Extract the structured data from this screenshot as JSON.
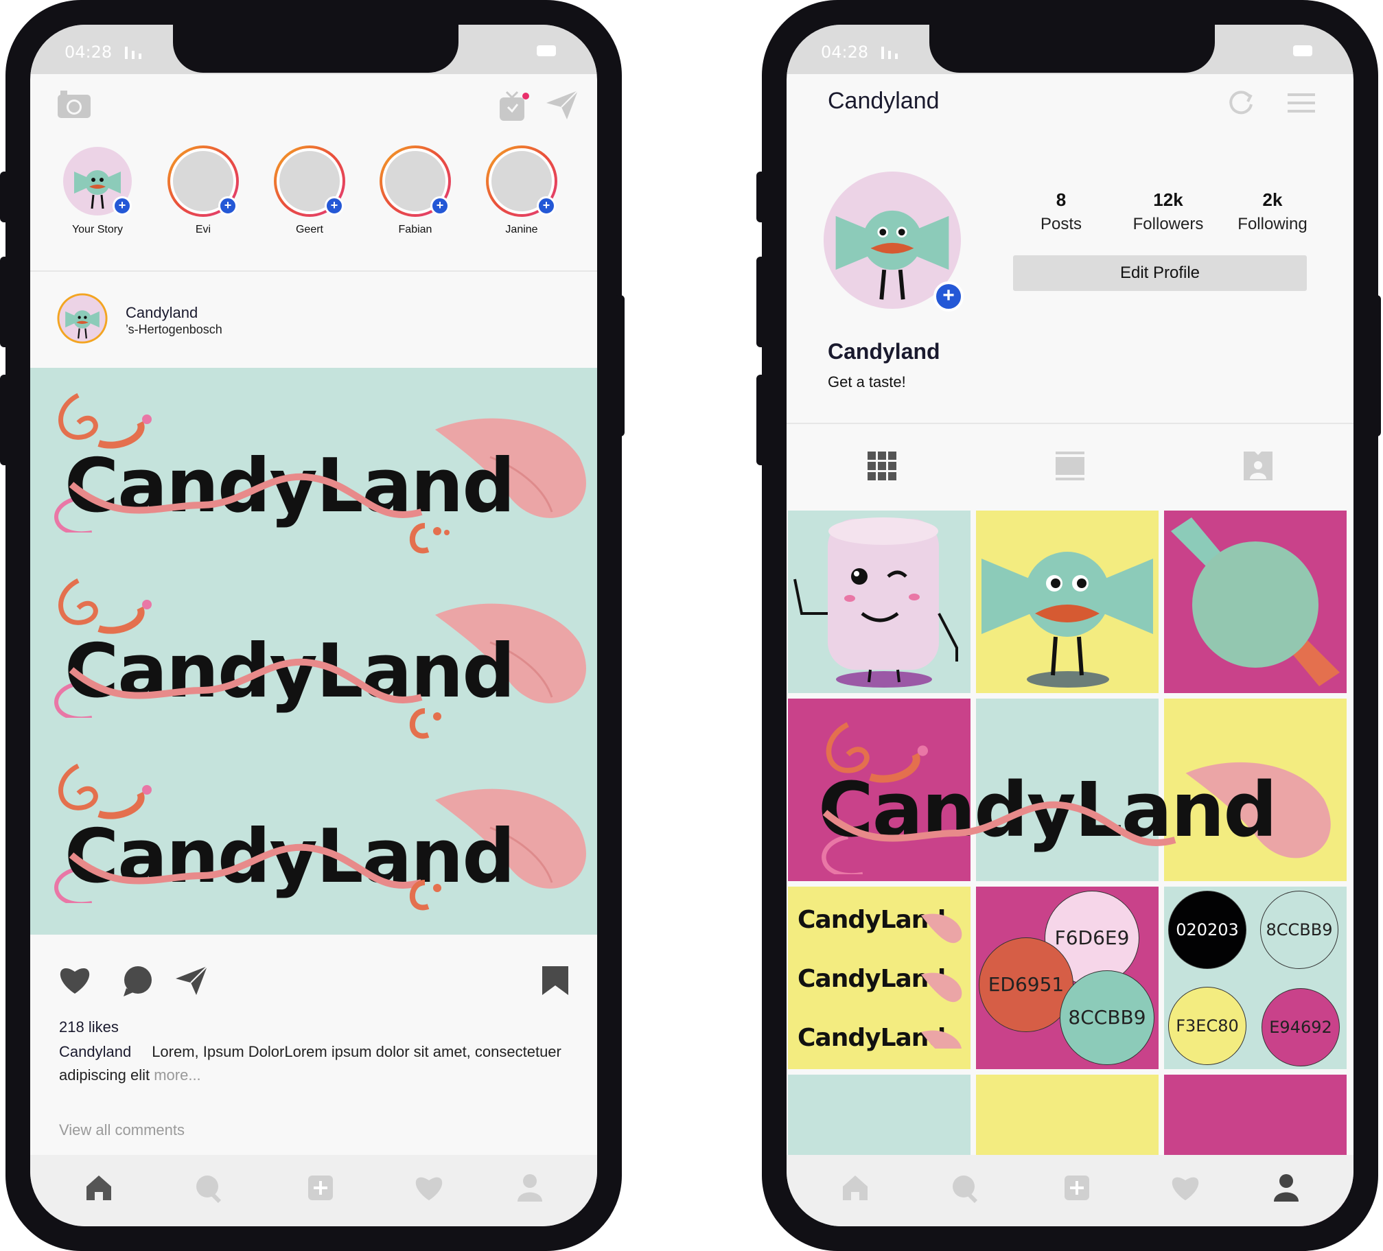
{
  "status_bar": {
    "time": "04:28"
  },
  "feed": {
    "stories": [
      {
        "name": "Your Story"
      },
      {
        "name": "Evi"
      },
      {
        "name": "Geert"
      },
      {
        "name": "Fabian"
      },
      {
        "name": "Janine"
      }
    ],
    "post": {
      "account": "Candyland",
      "location": "’s-Hertogenbosch",
      "image_text": "CandyLand",
      "likes": "218 likes",
      "caption_user": "Candyland",
      "caption_text": "Lorem, Ipsum DolorLorem ipsum dolor sit amet, consectetuer adipiscing elit",
      "more": "more...",
      "view_comments": "View all comments"
    }
  },
  "profile": {
    "header_title": "Candyland",
    "stats": [
      {
        "value": "8",
        "label": "Posts"
      },
      {
        "value": "12k",
        "label": "Followers"
      },
      {
        "value": "2k",
        "label": "Following"
      }
    ],
    "edit_button": "Edit Profile",
    "name": "Candyland",
    "bio": "Get a taste!",
    "grid_logo_text": "CandyLand",
    "swatches_a": [
      "F6D6E9",
      "ED6951",
      "8CCBB9"
    ],
    "swatches_b": [
      "020203",
      "8CCBB9",
      "F3EC80",
      "E94692"
    ]
  },
  "colors": {
    "mint": "#c5e3dc",
    "teal": "#8ccbb9",
    "yellow": "#f3ec80",
    "magenta": "#c9428a",
    "pink": "#eba5a6",
    "orange": "#e4704e",
    "blue": "#2458d6",
    "black": "#020203"
  }
}
